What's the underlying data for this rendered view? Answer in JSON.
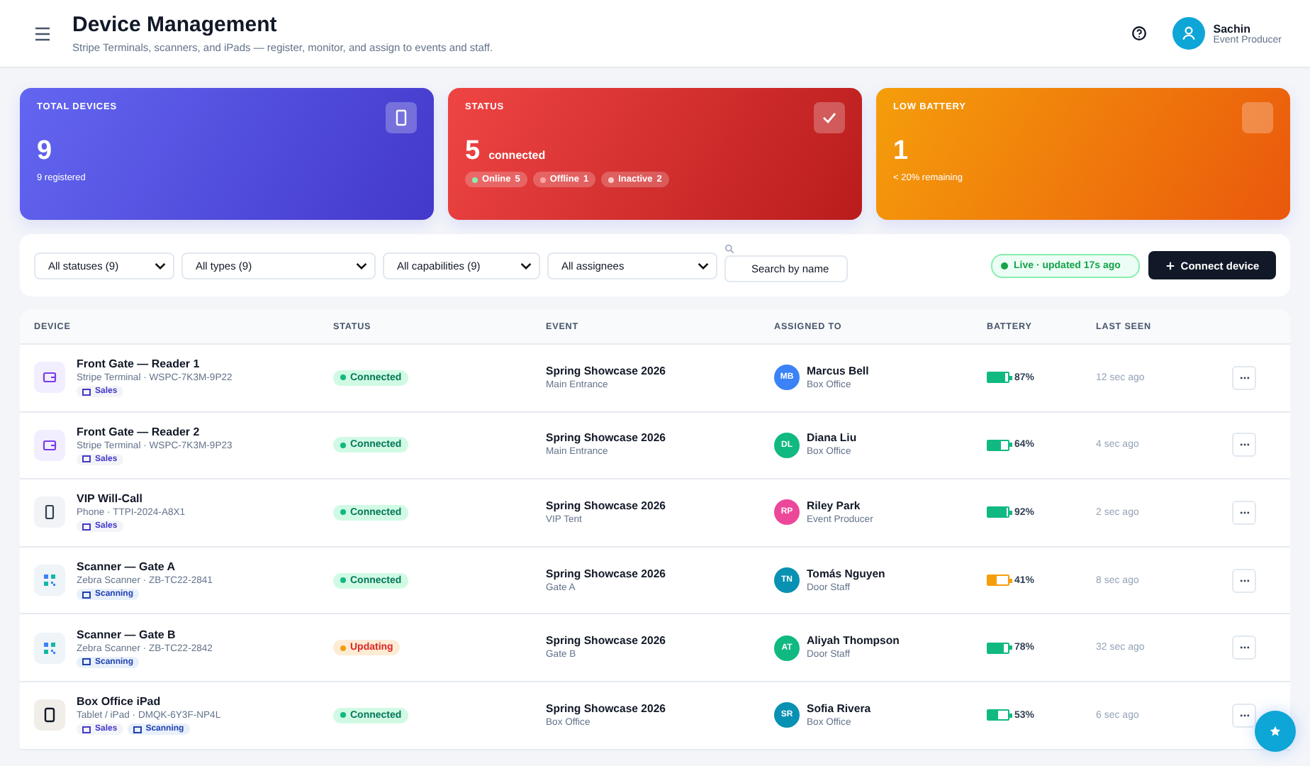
{
  "header": {
    "title": "Device Management",
    "subtitle": "Stripe Terminals, scanners, and iPads — register, monitor, and assign to events and staff.",
    "user": {
      "name": "Sachin",
      "role": "Event Producer"
    }
  },
  "stats": [
    {
      "kind": "total",
      "label": "TOTAL DEVICES",
      "value": "9",
      "caption": "9 registered"
    },
    {
      "kind": "status",
      "label": "STATUS",
      "value": "5",
      "unit": "connected",
      "chips": [
        {
          "label": "Online",
          "count": "5",
          "color": "#86efac"
        },
        {
          "label": "Offline",
          "count": "1",
          "color": "#fca5a5"
        },
        {
          "label": "Inactive",
          "count": "2",
          "color": "#fecaca"
        }
      ]
    },
    {
      "kind": "battery",
      "label": "LOW BATTERY",
      "value": "1",
      "caption": "< 20% remaining"
    }
  ],
  "filters": {
    "selects": [
      "All statuses (9)",
      "All types (9)",
      "All capabilities (9)",
      "All assignees"
    ],
    "search_placeholder": "Search by name",
    "live": "Live · updated 17s ago",
    "connect_button": "Connect device"
  },
  "table": {
    "columns": [
      "DEVICE",
      "STATUS",
      "EVENT",
      "ASSIGNED TO",
      "BATTERY",
      "LAST SEEN"
    ],
    "rows": [
      {
        "kind": "reader",
        "name": "Front Gate — Reader 1",
        "meta": "Stripe Terminal · WSPC-7K3M-9P22",
        "tags": [
          {
            "kind": "sales",
            "label": "Sales"
          }
        ],
        "status": {
          "kind": "connected",
          "label": "Connected"
        },
        "event": "Spring Showcase 2026",
        "location": "Main Entrance",
        "assignee": {
          "initials": "MB",
          "name": "Marcus Bell",
          "role": "Box Office",
          "color": "#3b82f6"
        },
        "battery": {
          "level": 0.87,
          "reading": "87%"
        },
        "last_seen": "12 sec ago"
      },
      {
        "kind": "reader",
        "name": "Front Gate — Reader 2",
        "meta": "Stripe Terminal · WSPC-7K3M-9P23",
        "tags": [
          {
            "kind": "sales",
            "label": "Sales"
          }
        ],
        "status": {
          "kind": "connected",
          "label": "Connected"
        },
        "event": "Spring Showcase 2026",
        "location": "Main Entrance",
        "assignee": {
          "initials": "DL",
          "name": "Diana Liu",
          "role": "Box Office",
          "color": "#10b981"
        },
        "battery": {
          "level": 0.64,
          "reading": "64%"
        },
        "last_seen": "4 sec ago"
      },
      {
        "kind": "phone",
        "name": "VIP Will-Call",
        "meta": "Phone · TTPI-2024-A8X1",
        "tags": [
          {
            "kind": "sales",
            "label": "Sales"
          }
        ],
        "status": {
          "kind": "connected",
          "label": "Connected"
        },
        "event": "Spring Showcase 2026",
        "location": "VIP Tent",
        "assignee": {
          "initials": "RP",
          "name": "Riley Park",
          "role": "Event Producer",
          "color": "#ec4899"
        },
        "battery": {
          "level": 0.92,
          "reading": "92%"
        },
        "last_seen": "2 sec ago"
      },
      {
        "kind": "scanner",
        "name": "Scanner — Gate A",
        "meta": "Zebra Scanner · ZB-TC22-2841",
        "tags": [
          {
            "kind": "scanning",
            "label": "Scanning"
          }
        ],
        "status": {
          "kind": "connected",
          "label": "Connected"
        },
        "event": "Spring Showcase 2026",
        "location": "Gate A",
        "assignee": {
          "initials": "TN",
          "name": "Tomás Nguyen",
          "role": "Door Staff",
          "color": "#0891b2"
        },
        "battery": {
          "level": 0.41,
          "reading": "41%"
        },
        "last_seen": "8 sec ago"
      },
      {
        "kind": "scanner",
        "name": "Scanner — Gate B",
        "meta": "Zebra Scanner · ZB-TC22-2842",
        "tags": [
          {
            "kind": "scanning",
            "label": "Scanning"
          }
        ],
        "status": {
          "kind": "updating",
          "label": "Updating"
        },
        "event": "Spring Showcase 2026",
        "location": "Gate B",
        "assignee": {
          "initials": "AT",
          "name": "Aliyah Thompson",
          "role": "Door Staff",
          "color": "#10b981"
        },
        "battery": {
          "level": 0.78,
          "reading": "78%"
        },
        "last_seen": "32 sec ago"
      },
      {
        "kind": "tablet",
        "name": "Box Office iPad",
        "meta": "Tablet / iPad · DMQK-6Y3F-NP4L",
        "tags": [
          {
            "kind": "sales",
            "label": "Sales"
          },
          {
            "kind": "scanning",
            "label": "Scanning"
          }
        ],
        "status": {
          "kind": "connected",
          "label": "Connected"
        },
        "event": "Spring Showcase 2026",
        "location": "Box Office",
        "assignee": {
          "initials": "SR",
          "name": "Sofia Rivera",
          "role": "Box Office",
          "color": "#0891b2"
        },
        "battery": {
          "level": 0.53,
          "reading": "53%"
        },
        "last_seen": "6 sec ago"
      }
    ]
  }
}
